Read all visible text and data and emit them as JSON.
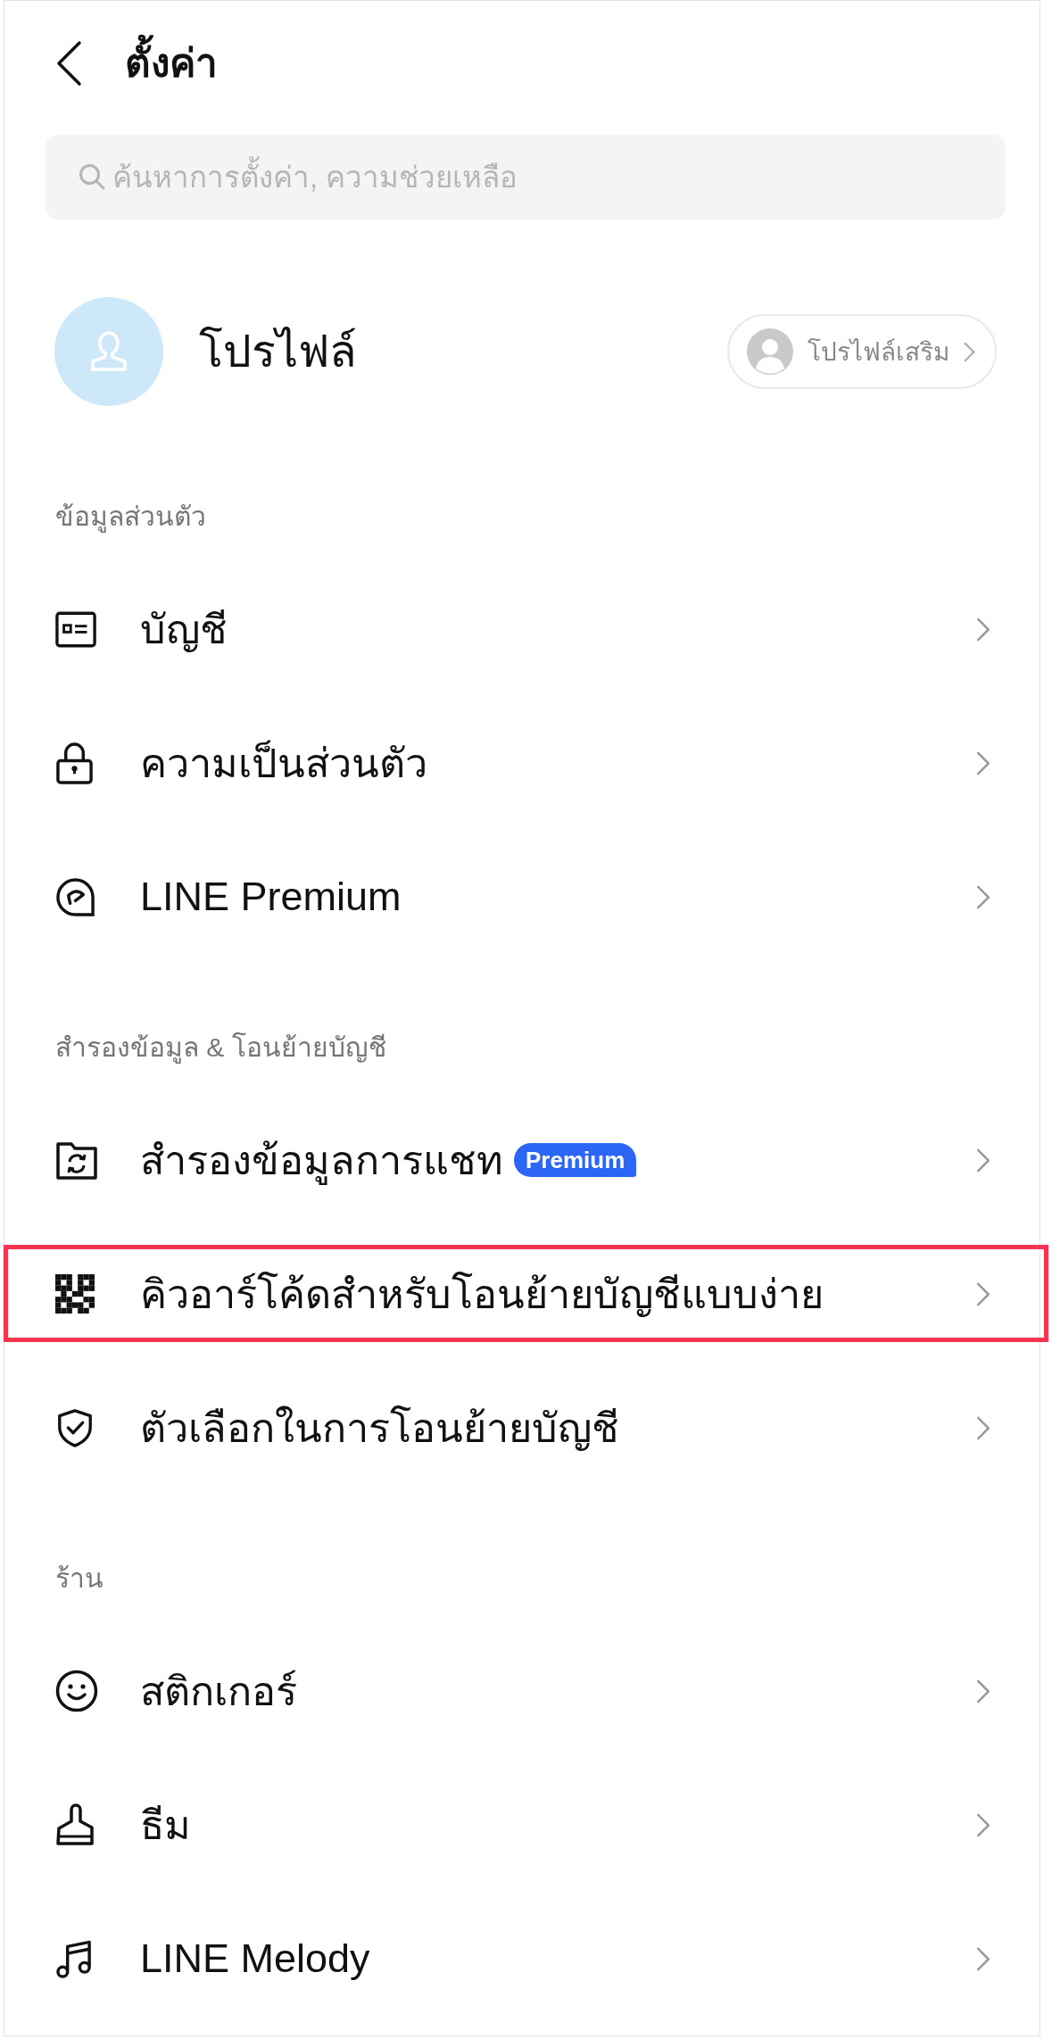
{
  "header": {
    "title": "ตั้งค่า"
  },
  "search": {
    "placeholder": "ค้นหาการตั้งค่า, ความช่วยเหลือ"
  },
  "profile": {
    "name": "โปรไฟล์",
    "sub_profile_button": "โปรไฟล์เสริม"
  },
  "sections": [
    {
      "title": "ข้อมูลส่วนตัว",
      "items": [
        {
          "label": "บัญชี",
          "highlighted": false
        },
        {
          "label": "ความเป็นส่วนตัว",
          "highlighted": false
        },
        {
          "label": "LINE Premium",
          "highlighted": false
        }
      ]
    },
    {
      "title": "สำรองข้อมูล & โอนย้ายบัญชี",
      "items": [
        {
          "label": "สำรองข้อมูลการแชท",
          "badge": "Premium",
          "highlighted": false
        },
        {
          "label": "คิวอาร์โค้ดสำหรับโอนย้ายบัญชีแบบง่าย",
          "highlighted": true
        },
        {
          "label": "ตัวเลือกในการโอนย้ายบัญชี",
          "highlighted": false
        }
      ]
    },
    {
      "title": "ร้าน",
      "items": [
        {
          "label": "สติกเกอร์",
          "highlighted": false
        },
        {
          "label": "ธีม",
          "highlighted": false
        },
        {
          "label": "LINE Melody",
          "highlighted": false
        }
      ]
    }
  ]
}
